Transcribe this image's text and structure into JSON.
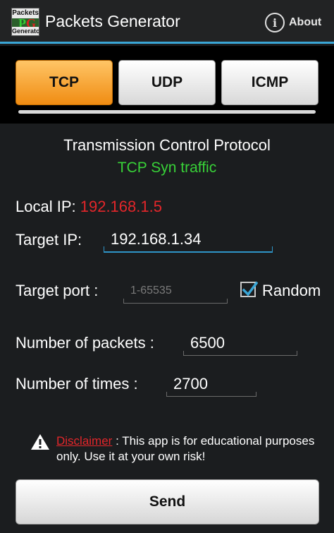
{
  "app": {
    "icon_top": "Packets",
    "icon_letters": "P",
    "icon_letter2": "G",
    "icon_bottom": "Generator",
    "title": "Packets Generator",
    "about_label": "About"
  },
  "tabs": [
    {
      "label": "TCP",
      "active": true
    },
    {
      "label": "UDP",
      "active": false
    },
    {
      "label": "ICMP",
      "active": false
    }
  ],
  "protocol": {
    "name": "Transmission Control Protocol",
    "mode": "TCP Syn traffic"
  },
  "form": {
    "local_ip_label": "Local IP:",
    "local_ip_value": "192.168.1.5",
    "target_ip_label": "Target IP:",
    "target_ip_value": "192.168.1.34",
    "target_port_label": "Target port :",
    "target_port_placeholder": "1-65535",
    "random_label": "Random",
    "random_checked": true,
    "packets_label": "Number of packets :",
    "packets_value": "6500",
    "times_label": "Number of times :",
    "times_value": "2700"
  },
  "disclaimer": {
    "label": "Disclaimer",
    "separator": " : ",
    "text": "This app is for educational purposes only. Use it at your own risk!"
  },
  "send_label": "Send",
  "colors": {
    "accent": "#3aa6d6",
    "active_tab": "#f08c12",
    "success": "#38d238",
    "danger": "#e3262a"
  }
}
